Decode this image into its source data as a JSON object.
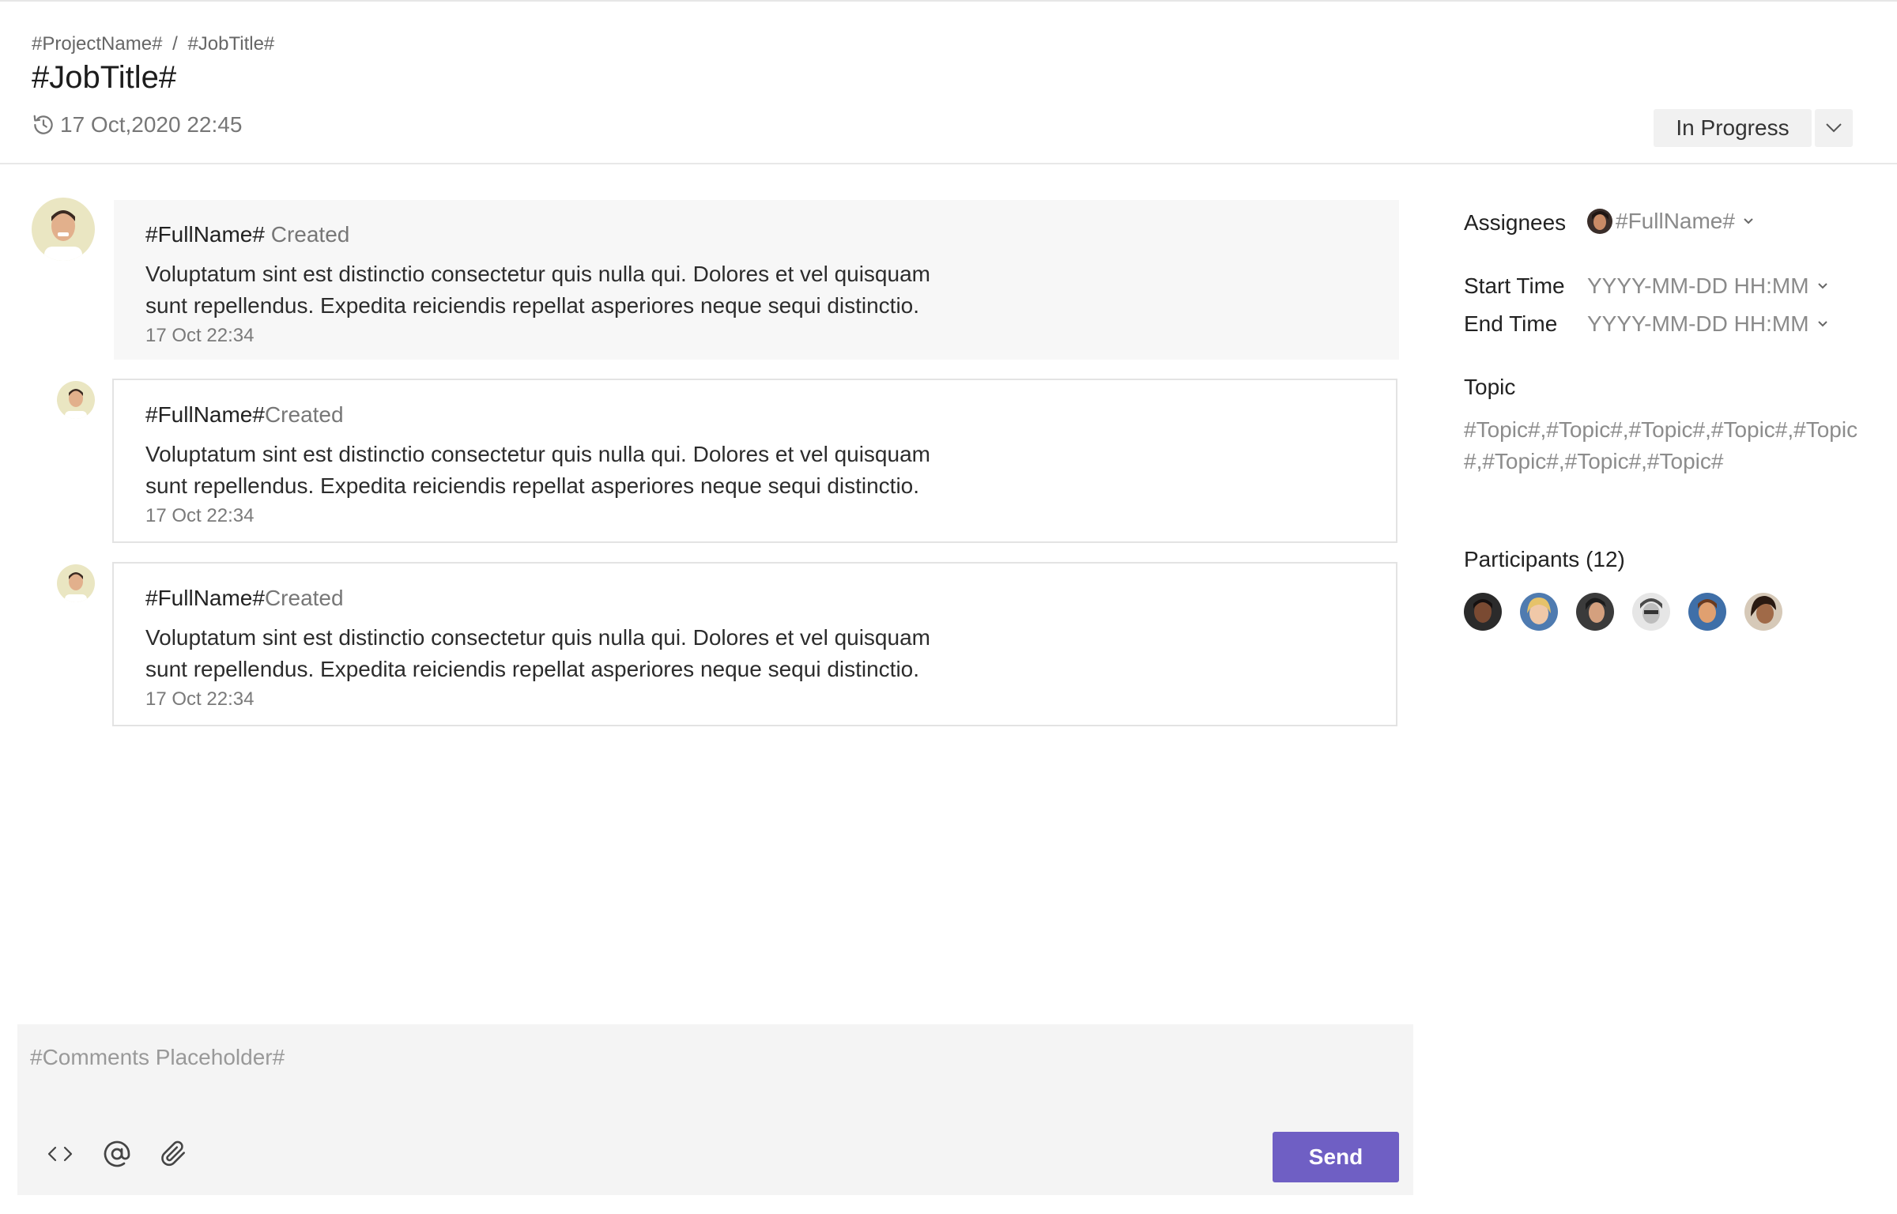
{
  "header": {
    "breadcrumb": {
      "project": "#ProjectName#",
      "separator": "/",
      "job": "#JobTitle#"
    },
    "title": "#JobTitle#",
    "timestamp": "17 Oct,2020 22:45",
    "status": "In Progress",
    "status_icon": "chevron-down-icon"
  },
  "activity": [
    {
      "name": "#FullName#",
      "action": "Created",
      "text_line1": "Voluptatum sint est distinctio consectetur quis nulla qui. Dolores et vel quisquam",
      "text_line2": "sunt repellendus. Expedita reiciendis repellat asperiores neque sequi distinctio.",
      "time": "17 Oct 22:34"
    },
    {
      "name": "#FullName#",
      "action": "Created",
      "text_line1": "Voluptatum sint est distinctio consectetur quis nulla qui. Dolores et vel quisquam",
      "text_line2": "sunt repellendus. Expedita reiciendis repellat asperiores neque sequi distinctio.",
      "time": "17 Oct 22:34"
    },
    {
      "name": "#FullName#",
      "action": "Created",
      "text_line1": "Voluptatum sint est distinctio consectetur quis nulla qui. Dolores et vel quisquam",
      "text_line2": "sunt repellendus. Expedita reiciendis repellat asperiores neque sequi distinctio.",
      "time": "17 Oct 22:34"
    }
  ],
  "editor": {
    "placeholder": "#Comments Placeholder#",
    "tools": [
      "code-icon",
      "at-mention-icon",
      "paperclip-icon"
    ],
    "send_label": "Send",
    "accent": "#6f5fc4"
  },
  "sidebar": {
    "assignees_label": "Assignees",
    "assignee_name": "#FullName#",
    "start_label": "Start Time",
    "start_value": "YYYY-MM-DD HH:MM",
    "end_label": "End Time",
    "end_value": "YYYY-MM-DD HH:MM",
    "topic_label": "Topic",
    "topics": "#Topic#,#Topic#,#Topic#,#Topic#,#Topic#,#Topic#,#Topic#,#Topic#",
    "participants_label": "Participants (12)",
    "participant_avatars": 6
  }
}
